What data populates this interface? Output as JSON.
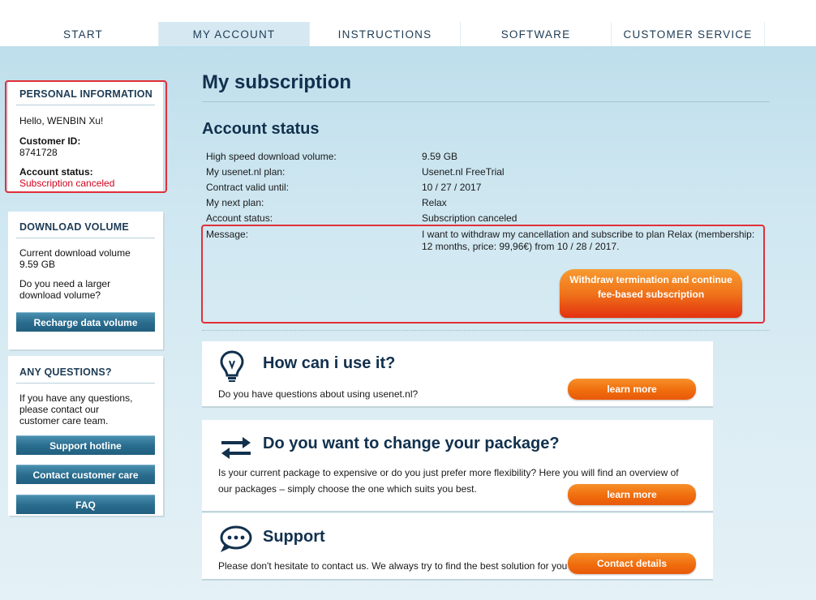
{
  "nav": {
    "tabs": [
      {
        "label": "START",
        "active": false
      },
      {
        "label": "MY ACCOUNT",
        "active": true
      },
      {
        "label": "INSTRUCTIONS",
        "active": false
      },
      {
        "label": "SOFTWARE",
        "active": false
      },
      {
        "label": "CUSTOMER SERVICE",
        "active": false
      }
    ]
  },
  "sidebar": {
    "personal": {
      "heading": "PERSONAL INFORMATION",
      "greeting": "Hello, WENBIN Xu!",
      "customer_id_label": "Customer ID:",
      "customer_id": "8741728",
      "status_label": "Account status:",
      "status_value": "Subscription canceled"
    },
    "download": {
      "heading": "DOWNLOAD VOLUME",
      "current_label": "Current download volume",
      "current_value": "9.59 GB",
      "question": "Do you need a larger download volume?",
      "button": "Recharge data volume"
    },
    "questions": {
      "heading": "ANY QUESTIONS?",
      "text": "If you have any questions, please contact our customer care team.",
      "buttons": [
        "Support hotline",
        "Contact customer care",
        "FAQ"
      ]
    }
  },
  "main": {
    "title": "My subscription",
    "section_title": "Account status",
    "rows": [
      {
        "label": "High speed download volume:",
        "value": "9.59 GB"
      },
      {
        "label": "My usenet.nl plan:",
        "value": "Usenet.nl FreeTrial"
      },
      {
        "label": "Contract valid until:",
        "value": "10 / 27 / 2017"
      },
      {
        "label": "My next plan:",
        "value": "Relax"
      },
      {
        "label": "Account status:",
        "value": "Subscription canceled"
      }
    ],
    "message_label": "Message:",
    "message_value": "I want to withdraw my cancellation and subscribe to plan Relax (membership: 12 months, price: 99,96€) from 10 / 28 / 2017.",
    "withdraw_button": "Withdraw termination and continue fee-based subscription"
  },
  "cards": [
    {
      "title": "How can i use it?",
      "text": "Do you have questions about using usenet.nl?",
      "button": "learn more",
      "icon": "lightbulb-icon"
    },
    {
      "title": "Do you want to change your package?",
      "text": "Is your current package to expensive or do you just prefer more flexibility? Here you will find an overview of our packages – simply choose the one which suits you best.",
      "button": "learn more",
      "icon": "swap-arrows-icon"
    },
    {
      "title": "Support",
      "text": "Please don't hesitate to contact us. We always try to find the best solution for you",
      "button": "Contact details",
      "icon": "speech-bubble-icon"
    }
  ],
  "colors": {
    "accent_orange": "#f06d0d",
    "sidebar_button": "#2a6d8f",
    "title_navy": "#11304d",
    "alert_red": "#d0021b",
    "highlight_frame": "#e0303a"
  }
}
